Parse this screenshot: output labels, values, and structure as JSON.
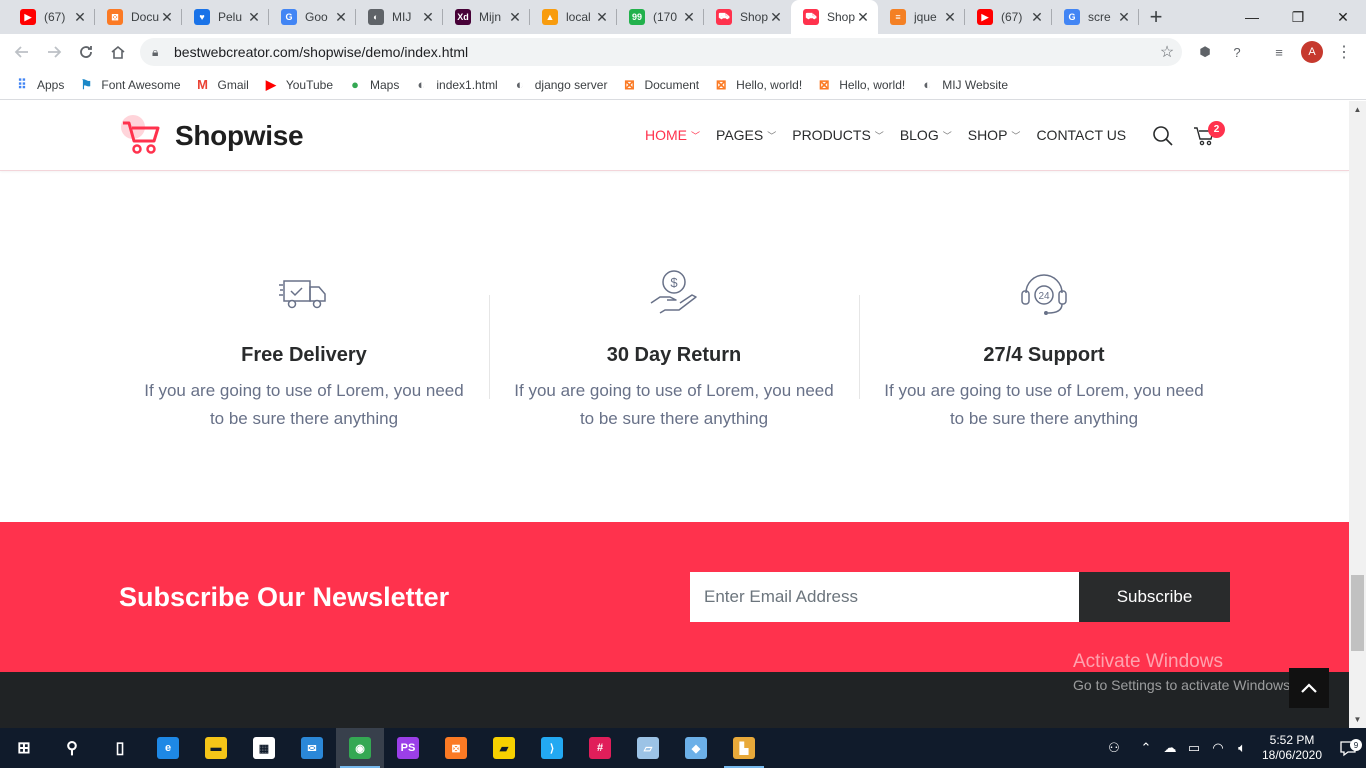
{
  "browser": {
    "tabs": [
      {
        "title": "(67)",
        "icon": "youtube-icon",
        "color": "#ff0000",
        "glyph": "▶"
      },
      {
        "title": "Docu",
        "icon": "xampp-icon",
        "color": "#fb7a24",
        "glyph": "⊠"
      },
      {
        "title": "Pelu",
        "icon": "shield-icon",
        "color": "#1a73e8",
        "glyph": "♥"
      },
      {
        "title": "Goo",
        "icon": "google-icon",
        "color": "#4285f4",
        "glyph": "G"
      },
      {
        "title": "MIJ",
        "icon": "globe-icon",
        "color": "#5f6368",
        "glyph": "◐"
      },
      {
        "title": "Mijn",
        "icon": "adobe-xd-icon",
        "color": "#470137",
        "glyph": "Xd"
      },
      {
        "title": "local",
        "icon": "phpmyadmin-icon",
        "color": "#f89c0e",
        "glyph": "▲"
      },
      {
        "title": "(170",
        "icon": "badge-99-icon",
        "color": "#22b14c",
        "glyph": "99"
      },
      {
        "title": "Shop",
        "icon": "shopwise-cart-icon",
        "color": "#ff324d",
        "glyph": "⛟"
      },
      {
        "title": "Shop",
        "icon": "shopwise-cart-icon",
        "color": "#ff324d",
        "glyph": "⛟",
        "active": true
      },
      {
        "title": "jque",
        "icon": "stackoverflow-icon",
        "color": "#f48024",
        "glyph": "≡"
      },
      {
        "title": "(67)",
        "icon": "youtube-icon",
        "color": "#ff0000",
        "glyph": "▶"
      },
      {
        "title": "scre",
        "icon": "google-icon",
        "color": "#4285f4",
        "glyph": "G"
      }
    ],
    "url": "bestwebcreator.com/shopwise/demo/index.html",
    "avatar_letter": "A",
    "bookmarks": [
      {
        "label": "Apps",
        "icon": "apps-grid-icon",
        "color": "#4285f4",
        "glyph": "⠿"
      },
      {
        "label": "Font Awesome",
        "icon": "flag-icon",
        "color": "#1c88c7",
        "glyph": "⚑"
      },
      {
        "label": "Gmail",
        "icon": "gmail-icon",
        "color": "#ea4335",
        "glyph": "M"
      },
      {
        "label": "YouTube",
        "icon": "youtube-icon",
        "color": "#ff0000",
        "glyph": "▶"
      },
      {
        "label": "Maps",
        "icon": "maps-pin-icon",
        "color": "#34a853",
        "glyph": "●"
      },
      {
        "label": "index1.html",
        "icon": "globe-icon",
        "color": "#5f6368",
        "glyph": "◐"
      },
      {
        "label": "django server",
        "icon": "globe-icon",
        "color": "#5f6368",
        "glyph": "◐"
      },
      {
        "label": "Document",
        "icon": "xampp-icon",
        "color": "#fb7a24",
        "glyph": "⊠"
      },
      {
        "label": "Hello, world!",
        "icon": "xampp-icon",
        "color": "#fb7a24",
        "glyph": "⊠"
      },
      {
        "label": "Hello, world!",
        "icon": "xampp-icon",
        "color": "#fb7a24",
        "glyph": "⊠"
      },
      {
        "label": "MIJ Website",
        "icon": "globe-icon",
        "color": "#5f6368",
        "glyph": "◐"
      }
    ]
  },
  "site": {
    "logo_text": "Shopwise",
    "nav": [
      {
        "label": "HOME",
        "active": true
      },
      {
        "label": "PAGES"
      },
      {
        "label": "PRODUCTS"
      },
      {
        "label": "BLOG"
      },
      {
        "label": "SHOP"
      },
      {
        "label": "CONTACT US",
        "no_chevron": true
      }
    ],
    "cart_count": "2",
    "features": [
      {
        "title": "Free Delivery",
        "text": "If you are going to use of Lorem, you need to be sure there anything",
        "icon": "delivery-truck-icon"
      },
      {
        "title": "30 Day Return",
        "text": "If you are going to use of Lorem, you need to be sure there anything",
        "icon": "money-hand-icon"
      },
      {
        "title": "27/4 Support",
        "text": "If you are going to use of Lorem, you need to be sure there anything",
        "icon": "headset-24-icon"
      }
    ],
    "newsletter": {
      "title": "Subscribe Our Newsletter",
      "placeholder": "Enter Email Address",
      "button": "Subscribe"
    },
    "accent_color": "#ff324d"
  },
  "watermark": {
    "line1": "Activate Windows",
    "line2": "Go to Settings to activate Windows."
  },
  "taskbar": {
    "apps": [
      {
        "name": "start-button",
        "glyph": "⊞",
        "color": "transparent"
      },
      {
        "name": "search-icon",
        "glyph": "⚲",
        "color": "transparent"
      },
      {
        "name": "task-view-icon",
        "glyph": "▯",
        "color": "transparent"
      },
      {
        "name": "edge-icon",
        "glyph": "e",
        "color": "#1e88e5"
      },
      {
        "name": "file-explorer-icon",
        "glyph": "▬",
        "color": "#f5c518"
      },
      {
        "name": "store-icon",
        "glyph": "▦",
        "color": "#ffffff"
      },
      {
        "name": "mail-icon",
        "glyph": "✉",
        "color": "#2b88d8"
      },
      {
        "name": "chrome-icon",
        "glyph": "◉",
        "color": "#34a853",
        "running": true,
        "active": true
      },
      {
        "name": "phpstorm-icon",
        "glyph": "PS",
        "color": "#9b3fe8"
      },
      {
        "name": "xampp-icon",
        "glyph": "⊠",
        "color": "#fb7a24"
      },
      {
        "name": "sticky-notes-icon",
        "glyph": "▰",
        "color": "#f7d100"
      },
      {
        "name": "vscode-icon",
        "glyph": "⟩",
        "color": "#23a9f2"
      },
      {
        "name": "slack-icon",
        "glyph": "#",
        "color": "#e01e5a"
      },
      {
        "name": "tablet-app-icon",
        "glyph": "▱",
        "color": "#9cc3e6"
      },
      {
        "name": "git-icon",
        "glyph": "◆",
        "color": "#6cb0e8"
      },
      {
        "name": "folder-app-icon",
        "glyph": "▙",
        "color": "#e8a93a",
        "running": true
      }
    ],
    "time": "5:52 PM",
    "date": "18/06/2020",
    "notifications": "9"
  }
}
